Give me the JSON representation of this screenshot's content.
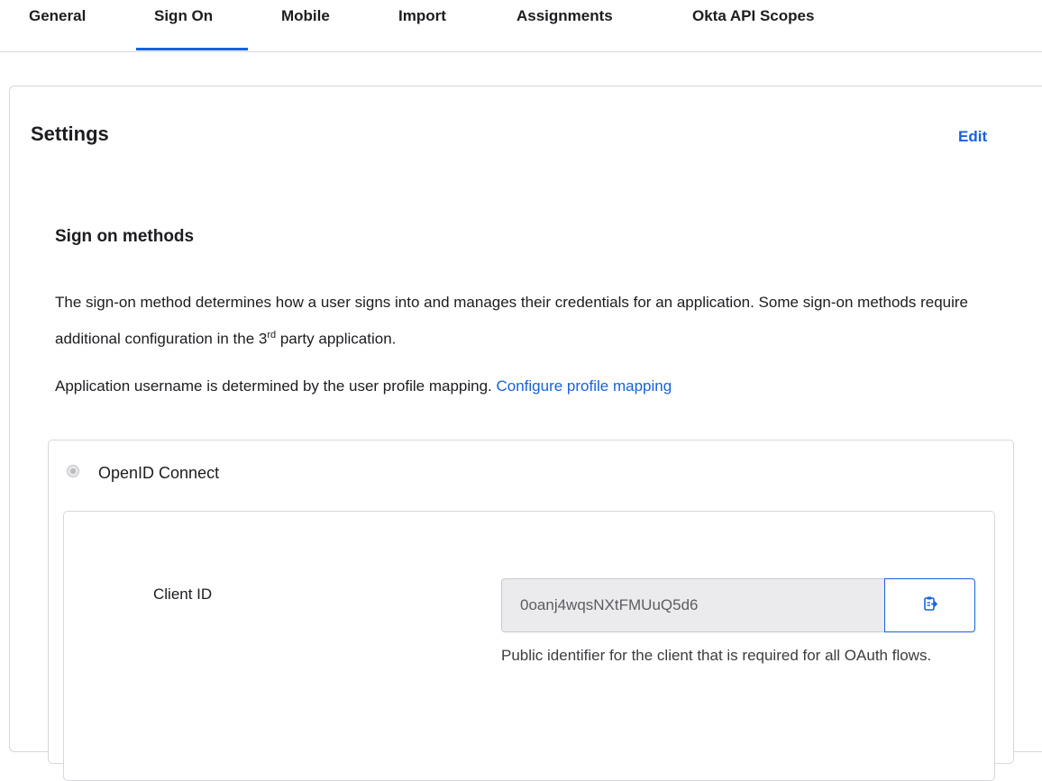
{
  "tabs": [
    {
      "label": "General"
    },
    {
      "label": "Sign On"
    },
    {
      "label": "Mobile"
    },
    {
      "label": "Import"
    },
    {
      "label": "Assignments"
    },
    {
      "label": "Okta API Scopes"
    }
  ],
  "active_tab": "Sign On",
  "settings": {
    "title": "Settings",
    "edit_label": "Edit",
    "sign_on_methods": {
      "title": "Sign on methods",
      "description_part1": "The sign-on method determines how a user signs into and manages their credentials for an application. Some sign-on methods require additional configuration in the 3",
      "description_sup": "rd",
      "description_part2": " party application.",
      "mapping_text": "Application username is determined by the user profile mapping. ",
      "mapping_link": "Configure profile mapping"
    },
    "method": {
      "label": "OpenID Connect",
      "client_id": {
        "label": "Client ID",
        "value": "0oanj4wqsNXtFMUuQ5d6",
        "help": "Public identifier for the client that is required for all OAuth flows."
      }
    }
  },
  "icons": {
    "copy": "clipboard-copy-icon",
    "radio": "radio-disabled"
  },
  "colors": {
    "accent": "#1662dd",
    "border": "#d7d7dc",
    "input_bg": "#ebebed"
  }
}
